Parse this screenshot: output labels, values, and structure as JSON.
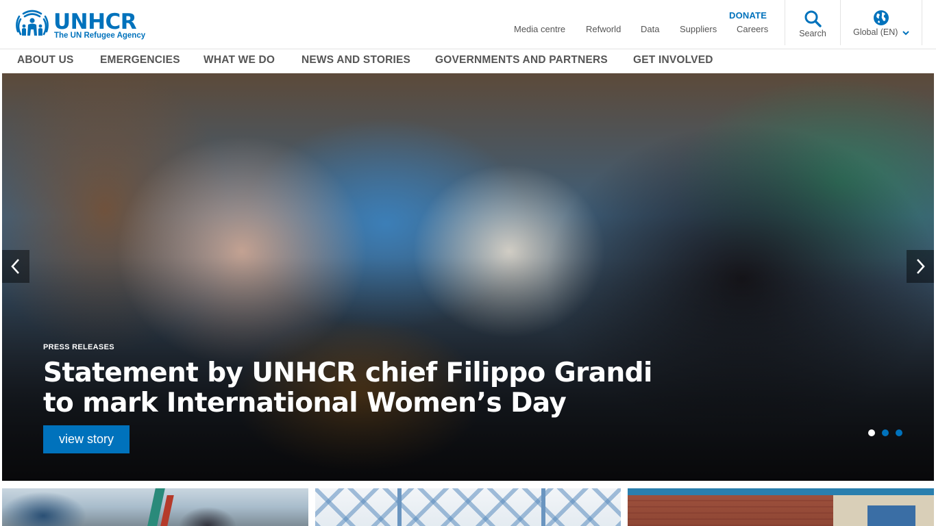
{
  "brand": {
    "name": "UNHCR",
    "tagline": "The UN Refugee Agency",
    "accent_color": "#0072bc",
    "logo_icon": "unhcr-emblem-icon"
  },
  "utility_nav": {
    "donate": "DONATE",
    "links": [
      "Media centre",
      "Refworld",
      "Data",
      "Suppliers",
      "Careers"
    ]
  },
  "tools": {
    "search": {
      "label": "Search",
      "icon": "search-icon"
    },
    "language": {
      "label": "Global (EN)",
      "icon": "globe-icon",
      "dropdown_icon": "chevron-down-icon"
    }
  },
  "main_nav": {
    "items": [
      "ABOUT US",
      "EMERGENCIES",
      "WHAT WE DO",
      "NEWS AND STORIES",
      "GOVERNMENTS AND PARTNERS",
      "GET INVOLVED"
    ]
  },
  "hero": {
    "kicker": "PRESS RELEASES",
    "title": "Statement by UNHCR chief Filippo Grandi to mark International Women’s Day",
    "cta": "view story",
    "prev_icon": "chevron-left-icon",
    "next_icon": "chevron-right-icon",
    "slide_count": 3,
    "active_slide": 1
  },
  "teasers": {
    "count": 3
  }
}
